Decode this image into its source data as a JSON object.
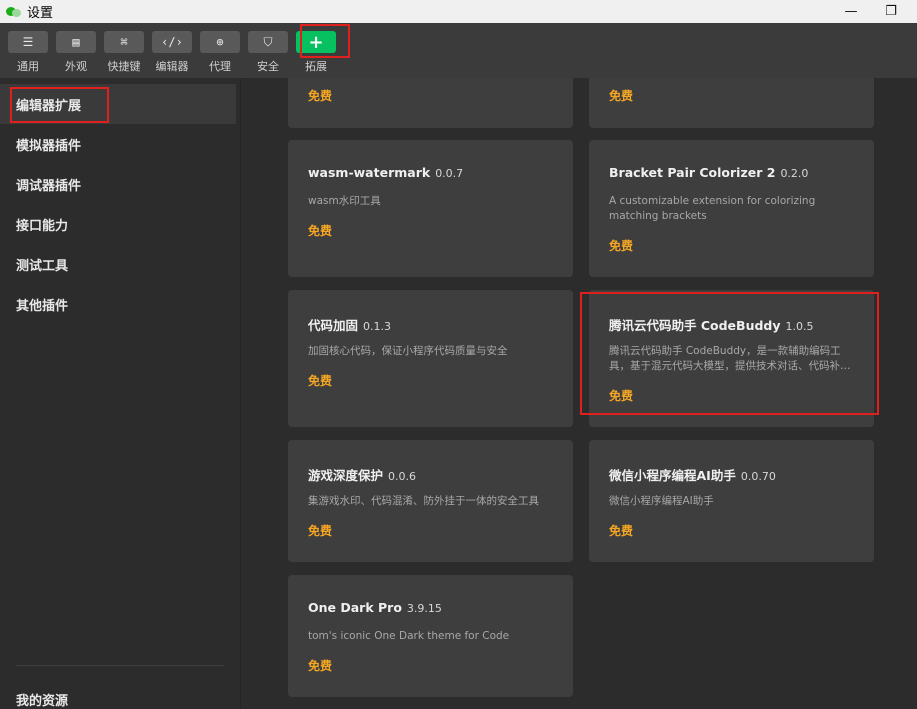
{
  "window": {
    "title": "设置",
    "minimize_glyph": "—",
    "restore_glyph": "❐"
  },
  "toolbar": {
    "items": [
      {
        "label": "通用",
        "icon": "sliders-icon",
        "glyph": "☰"
      },
      {
        "label": "外观",
        "icon": "window-layout-icon",
        "glyph": "▤"
      },
      {
        "label": "快捷键",
        "icon": "command-key-icon",
        "glyph": "⌘"
      },
      {
        "label": "编辑器",
        "icon": "code-brackets-icon",
        "glyph": "‹/›"
      },
      {
        "label": "代理",
        "icon": "globe-icon",
        "glyph": "⊕"
      },
      {
        "label": "安全",
        "icon": "shield-icon",
        "glyph": "⛉"
      },
      {
        "label": "拓展",
        "icon": "plus-icon",
        "glyph": "+"
      }
    ],
    "accent": "#07c160"
  },
  "sidebar": {
    "items": [
      {
        "label": "编辑器扩展",
        "active": true
      },
      {
        "label": "模拟器插件"
      },
      {
        "label": "调试器插件"
      },
      {
        "label": "接口能力"
      },
      {
        "label": "测试工具"
      },
      {
        "label": "其他插件"
      }
    ],
    "footer": "我的资源"
  },
  "extensions": [
    {
      "name": "",
      "version": "",
      "desc": "",
      "price": "免费"
    },
    {
      "name": "",
      "version": "",
      "desc": "",
      "price": "免费"
    },
    {
      "name": "wasm-watermark",
      "version": "0.0.7",
      "desc": "wasm水印工具",
      "price": "免费"
    },
    {
      "name": "Bracket Pair Colorizer 2",
      "version": "0.2.0",
      "desc": "A customizable extension for colorizing matching brackets",
      "price": "免费"
    },
    {
      "name": "代码加固",
      "version": "0.1.3",
      "desc": "加固核心代码，保证小程序代码质量与安全",
      "price": "免费"
    },
    {
      "name": "腾讯云代码助手 CodeBuddy",
      "version": "1.0.5",
      "desc": "腾讯云代码助手 CodeBuddy，是一款辅助编码工具，基于混元代码大模型，提供技术对话、代码补全等能力",
      "price": "免费"
    },
    {
      "name": "游戏深度保护",
      "version": "0.0.6",
      "desc": "集游戏水印、代码混淆、防外挂于一体的安全工具",
      "price": "免费"
    },
    {
      "name": "微信小程序编程AI助手",
      "version": "0.0.70",
      "desc": "微信小程序编程AI助手",
      "price": "免费"
    },
    {
      "name": "One Dark Pro",
      "version": "3.9.15",
      "desc": "tom's iconic One Dark theme for Code",
      "price": "免费"
    }
  ],
  "colors": {
    "price": "#f5a623",
    "highlight": "#e0201c"
  }
}
